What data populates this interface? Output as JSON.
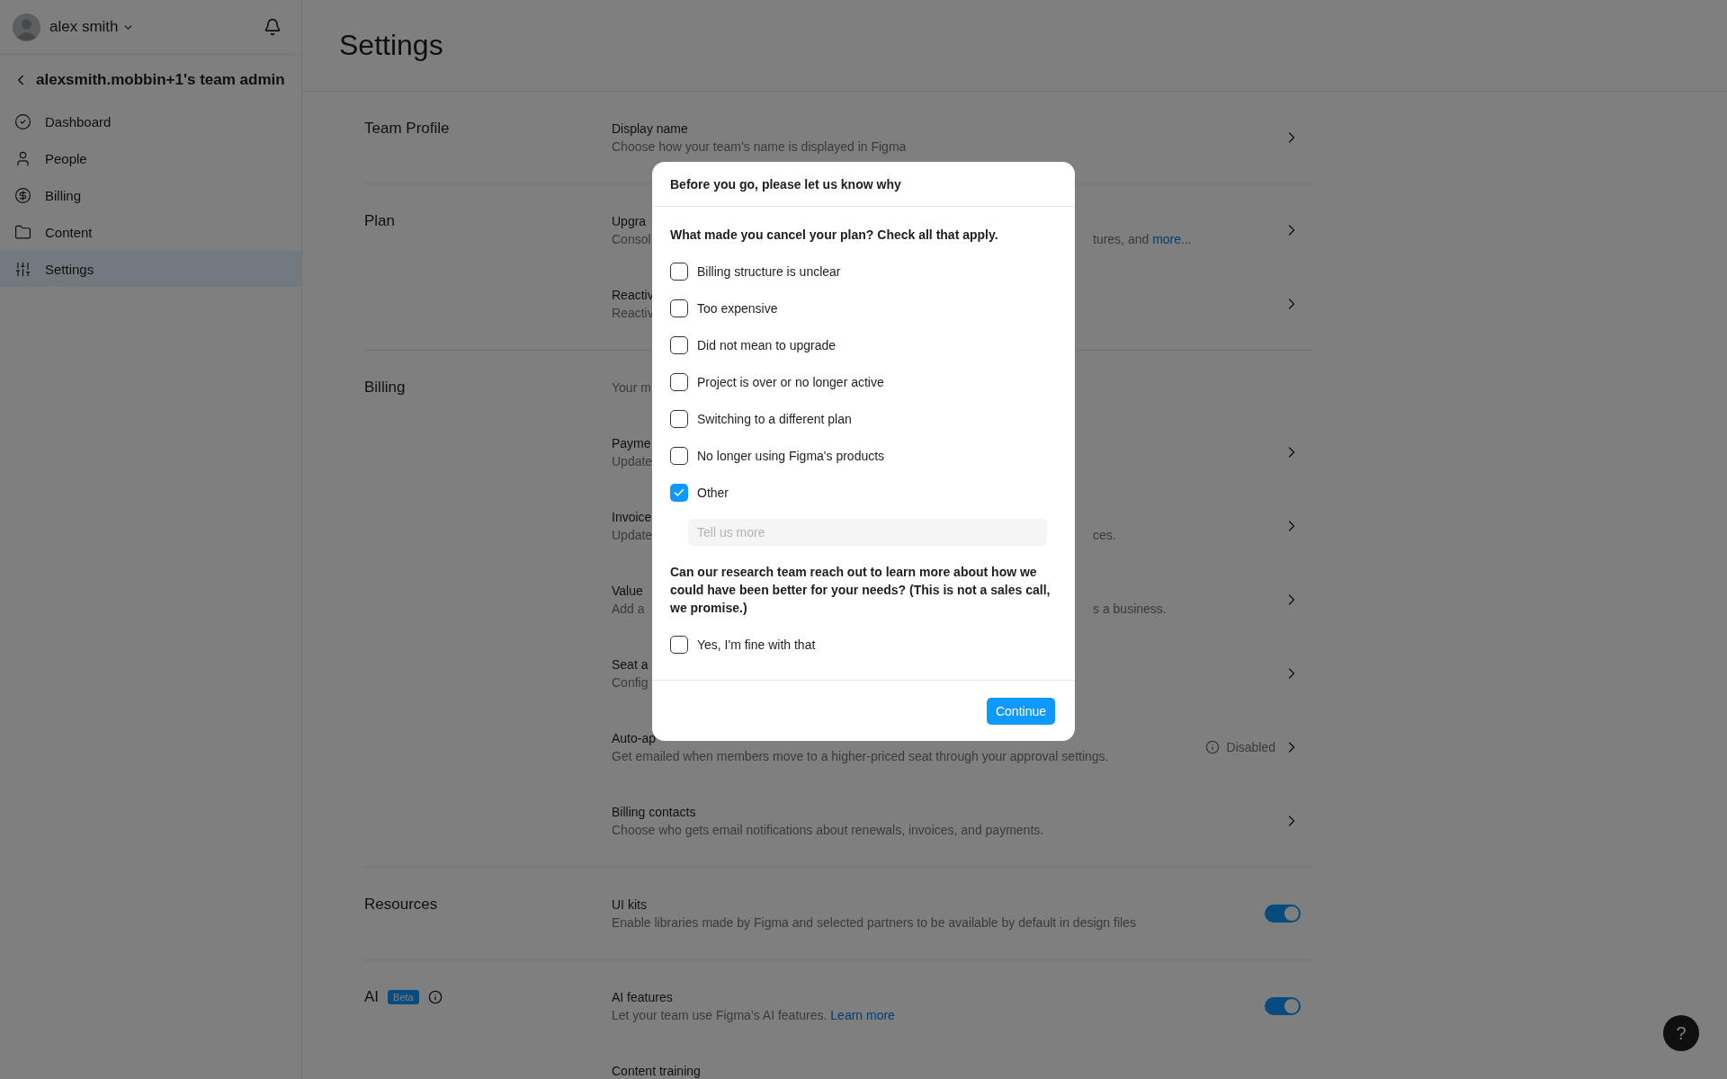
{
  "sidebar": {
    "user": {
      "name": "alex smith"
    },
    "team": {
      "title": "alexsmith.mobbin+1's team admin"
    },
    "items": [
      {
        "label": "Dashboard",
        "selected": false
      },
      {
        "label": "People",
        "selected": false
      },
      {
        "label": "Billing",
        "selected": false
      },
      {
        "label": "Content",
        "selected": false
      },
      {
        "label": "Settings",
        "selected": true
      }
    ]
  },
  "page": {
    "title": "Settings"
  },
  "sections": [
    {
      "label": "Team Profile",
      "rows": [
        {
          "kind": "chevron",
          "title": "Display name",
          "description": "Choose how your team’s name is displayed in Figma"
        }
      ]
    },
    {
      "label": "Plan",
      "rows": [
        {
          "kind": "chevron",
          "title": "Upgra",
          "description": "Consol",
          "tail": "tures, and ",
          "tail_link": "more..."
        },
        {
          "kind": "chevron",
          "title": "Reactiv",
          "description": "Reactiv"
        }
      ]
    },
    {
      "label": "Billing",
      "rows": [
        {
          "kind": "plain",
          "description": "Your m"
        },
        {
          "kind": "chevron",
          "title": "Payme",
          "description": "Update"
        },
        {
          "kind": "chevron",
          "title": "Invoice",
          "description": "Update",
          "tail": "ces."
        },
        {
          "kind": "chevron",
          "title": "Value",
          "description": "Add a",
          "tail": "s a business."
        },
        {
          "kind": "chevron",
          "title": "Seat a",
          "description": "Config"
        },
        {
          "kind": "chevron",
          "title": "Auto-ap",
          "description": "Get emailed when members move to a higher-priced seat through your approval settings.",
          "status": "Disabled"
        },
        {
          "kind": "chevron",
          "title": "Billing contacts",
          "description": "Choose who gets email notifications about renewals, invoices, and payments."
        }
      ]
    },
    {
      "label": "Resources",
      "rows": [
        {
          "kind": "toggle",
          "on": true,
          "title": "UI kits",
          "description": "Enable libraries made by Figma and selected partners to be available by default in design files"
        }
      ]
    },
    {
      "label": "AI",
      "badge": "Beta",
      "rows": [
        {
          "kind": "toggle",
          "on": true,
          "title": "AI features",
          "description": "Let your team use Figma’s AI features. ",
          "link": "Learn more"
        },
        {
          "kind": "plain",
          "title": "Content training"
        }
      ]
    }
  ],
  "modal": {
    "title": "Before you go, please let us know why",
    "question": "What made you cancel your plan? Check all that apply.",
    "reasons": [
      {
        "label": "Billing structure is unclear",
        "checked": false
      },
      {
        "label": "Too expensive",
        "checked": false
      },
      {
        "label": "Did not mean to upgrade",
        "checked": false
      },
      {
        "label": "Project is over or no longer active",
        "checked": false
      },
      {
        "label": "Switching to a different plan",
        "checked": false
      },
      {
        "label": "No longer using Figma's products",
        "checked": false
      },
      {
        "label": "Other",
        "checked": true
      }
    ],
    "other_field": {
      "placeholder": "Tell us more"
    },
    "research_question": "Can our research team reach out to learn more about how we could have been better for your needs? (This is not a sales call, we promise.)",
    "consent": {
      "label": "Yes, I'm fine with that",
      "checked": false
    },
    "button": "Continue"
  },
  "help_button": {
    "label": "?"
  }
}
